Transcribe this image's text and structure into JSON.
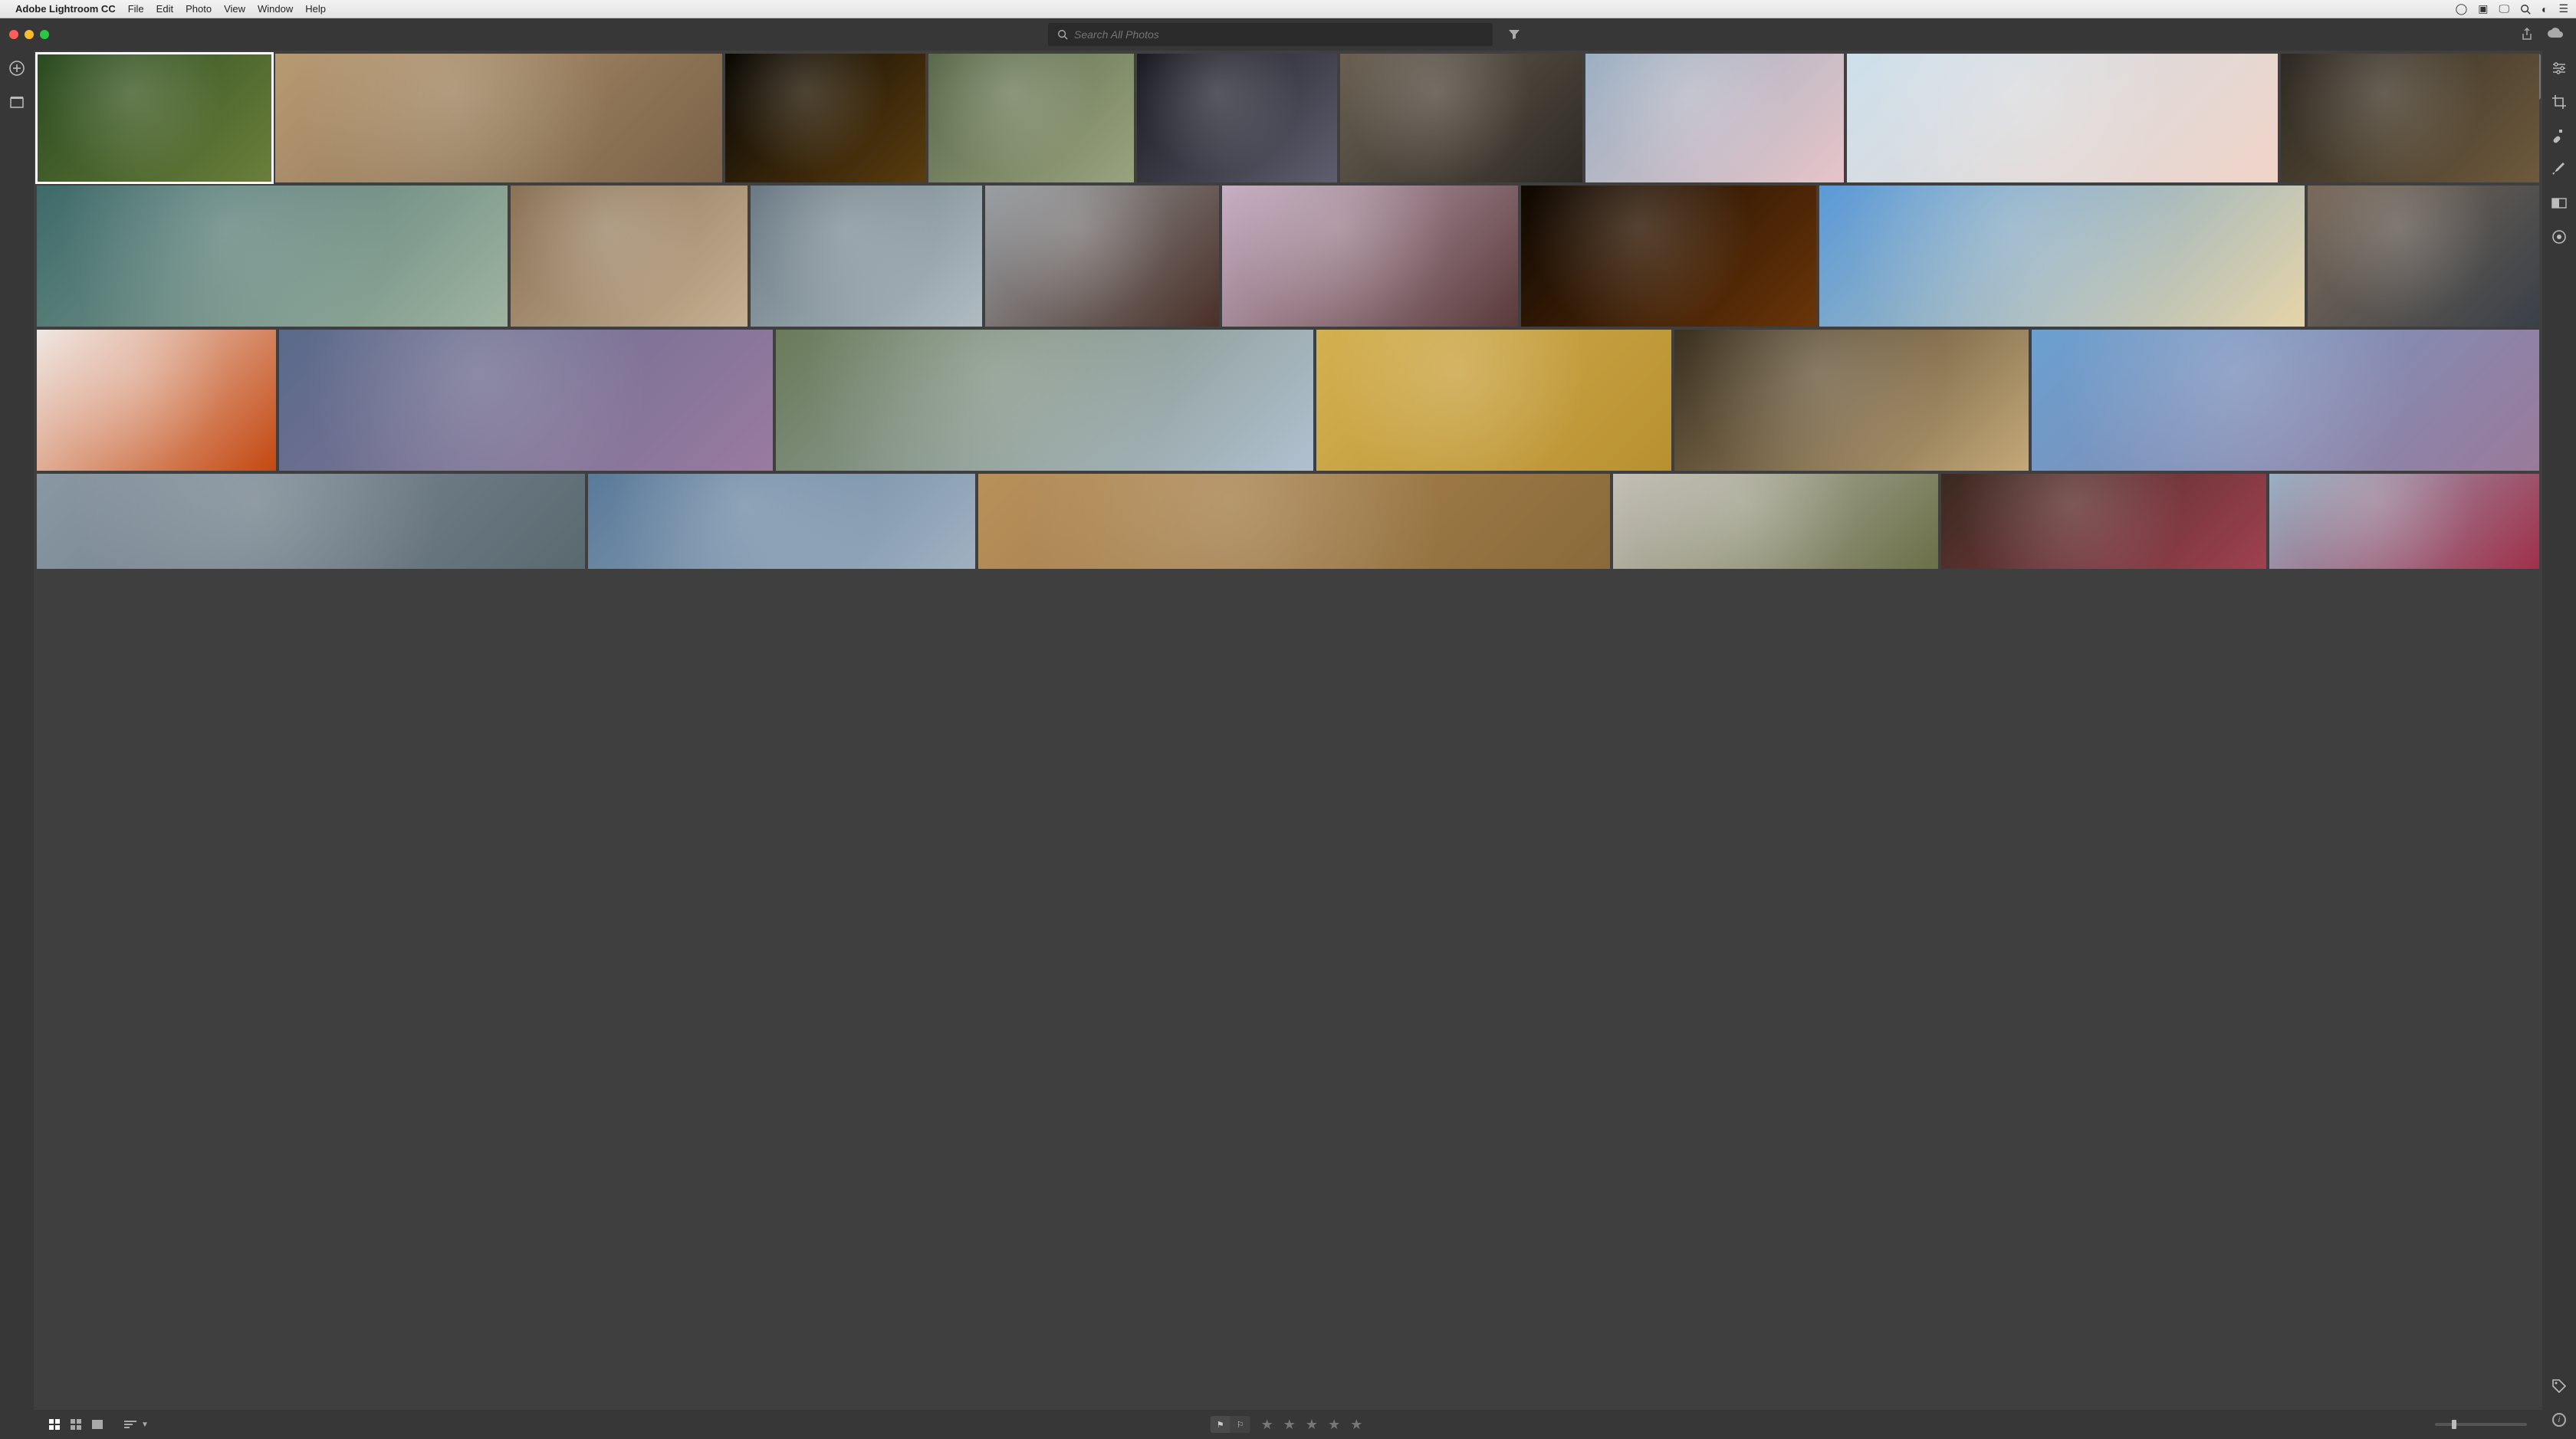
{
  "menubar": {
    "app": "Adobe Lightroom CC",
    "items": [
      "File",
      "Edit",
      "Photo",
      "View",
      "Window",
      "Help"
    ]
  },
  "toolbar": {
    "search_placeholder": "Search All Photos"
  },
  "grid": {
    "rows": [
      [
        {
          "selected": true,
          "c1": "#2a4a20",
          "c2": "#6a7f3a"
        },
        {
          "c1": "#b89a72",
          "c2": "#7a6248"
        },
        {
          "c1": "#0a0804",
          "c2": "#5a3c0e"
        },
        {
          "c1": "#5b6a4a",
          "c2": "#9aa37f"
        },
        {
          "c1": "#1a1a22",
          "c2": "#5e5e6e"
        },
        {
          "c1": "#6a6052",
          "c2": "#2e2a24"
        },
        {
          "c1": "#9bb0c3",
          "c2": "#e6c4c8"
        },
        {
          "c1": "#cde0ec",
          "c2": "#f0d4c8"
        },
        {
          "c1": "#2e2a24",
          "c2": "#6e5a3c"
        }
      ],
      [
        {
          "c1": "#3e6a6a",
          "c2": "#9fb3a0"
        },
        {
          "c1": "#8a7256",
          "c2": "#c4b092"
        },
        {
          "c1": "#6a7a84",
          "c2": "#b0bcc2"
        },
        {
          "c1": "#9aa0a4",
          "c2": "#4a3028"
        },
        {
          "c1": "#c8b0c4",
          "c2": "#5a3a3a"
        },
        {
          "c1": "#0e0802",
          "c2": "#6a3408"
        },
        {
          "c1": "#5a9ad8",
          "c2": "#e6d4a8"
        },
        {
          "c1": "#7a6a5a",
          "c2": "#3a4048"
        }
      ],
      [
        {
          "c1": "#f0e8e4",
          "c2": "#c44810"
        },
        {
          "c1": "#5a6a8a",
          "c2": "#9a7aa0"
        },
        {
          "c1": "#6a7a5a",
          "c2": "#b0c0d0"
        },
        {
          "c1": "#d4b050",
          "c2": "#b89030"
        },
        {
          "c1": "#3a3020",
          "c2": "#c4a878"
        },
        {
          "c1": "#6aa0d0",
          "c2": "#9a7a9a"
        }
      ],
      [
        {
          "c1": "#8a98a4",
          "c2": "#5a6870"
        },
        {
          "c1": "#5a7a9a",
          "c2": "#a0b0c0"
        },
        {
          "c1": "#b8905a",
          "c2": "#8a6a3a"
        },
        {
          "c1": "#c4c0b8",
          "c2": "#6a7048"
        },
        {
          "c1": "#3a2a20",
          "c2": "#a04050"
        },
        {
          "c1": "#9ab0c4",
          "c2": "#a0304a"
        }
      ]
    ],
    "row_specs": [
      [
        141,
        268,
        120,
        123,
        120,
        145,
        155,
        258,
        155
      ],
      [
        264,
        133,
        130,
        131,
        166,
        166,
        272,
        130
      ],
      [
        128,
        265,
        288,
        190,
        190,
        272
      ],
      [
        295,
        208,
        340,
        175,
        175,
        145
      ]
    ]
  },
  "bottom": {
    "stars": "★ ★ ★ ★ ★"
  }
}
